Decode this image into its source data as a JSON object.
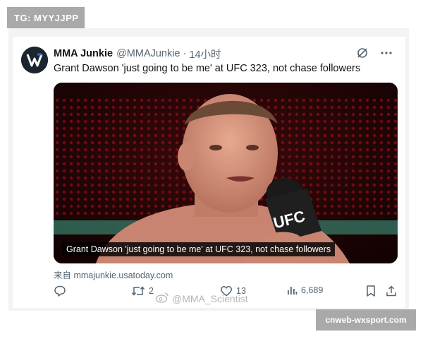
{
  "overlay_tags": {
    "top_left": "TG: MYYJJPP",
    "bottom_right": "cnweb-wxsport.com"
  },
  "tweet": {
    "author_name": "MMA Junkie",
    "author_handle": "@MMAJunkie",
    "separator": "·",
    "time": "14小时",
    "text": "Grant Dawson 'just going to be me' at UFC 323, not chase followers",
    "media_caption": "Grant Dawson 'just going to be me' at UFC 323, not chase followers",
    "media_logo": "UFC",
    "source": "来自 mmajunkie.usatoday.com",
    "actions": {
      "retweets": "2",
      "likes": "13",
      "views": "6,689"
    }
  },
  "watermark": "@MMA_Scientist",
  "icons": {
    "header": [
      "grok-slash-icon",
      "more-icon"
    ],
    "actions": [
      "reply-icon",
      "retweet-icon",
      "like-icon",
      "views-icon",
      "bookmark-icon",
      "share-icon"
    ]
  },
  "colors": {
    "text_primary": "#0f1419",
    "text_secondary": "#536471",
    "tag_bg": "#a9a9a9"
  }
}
